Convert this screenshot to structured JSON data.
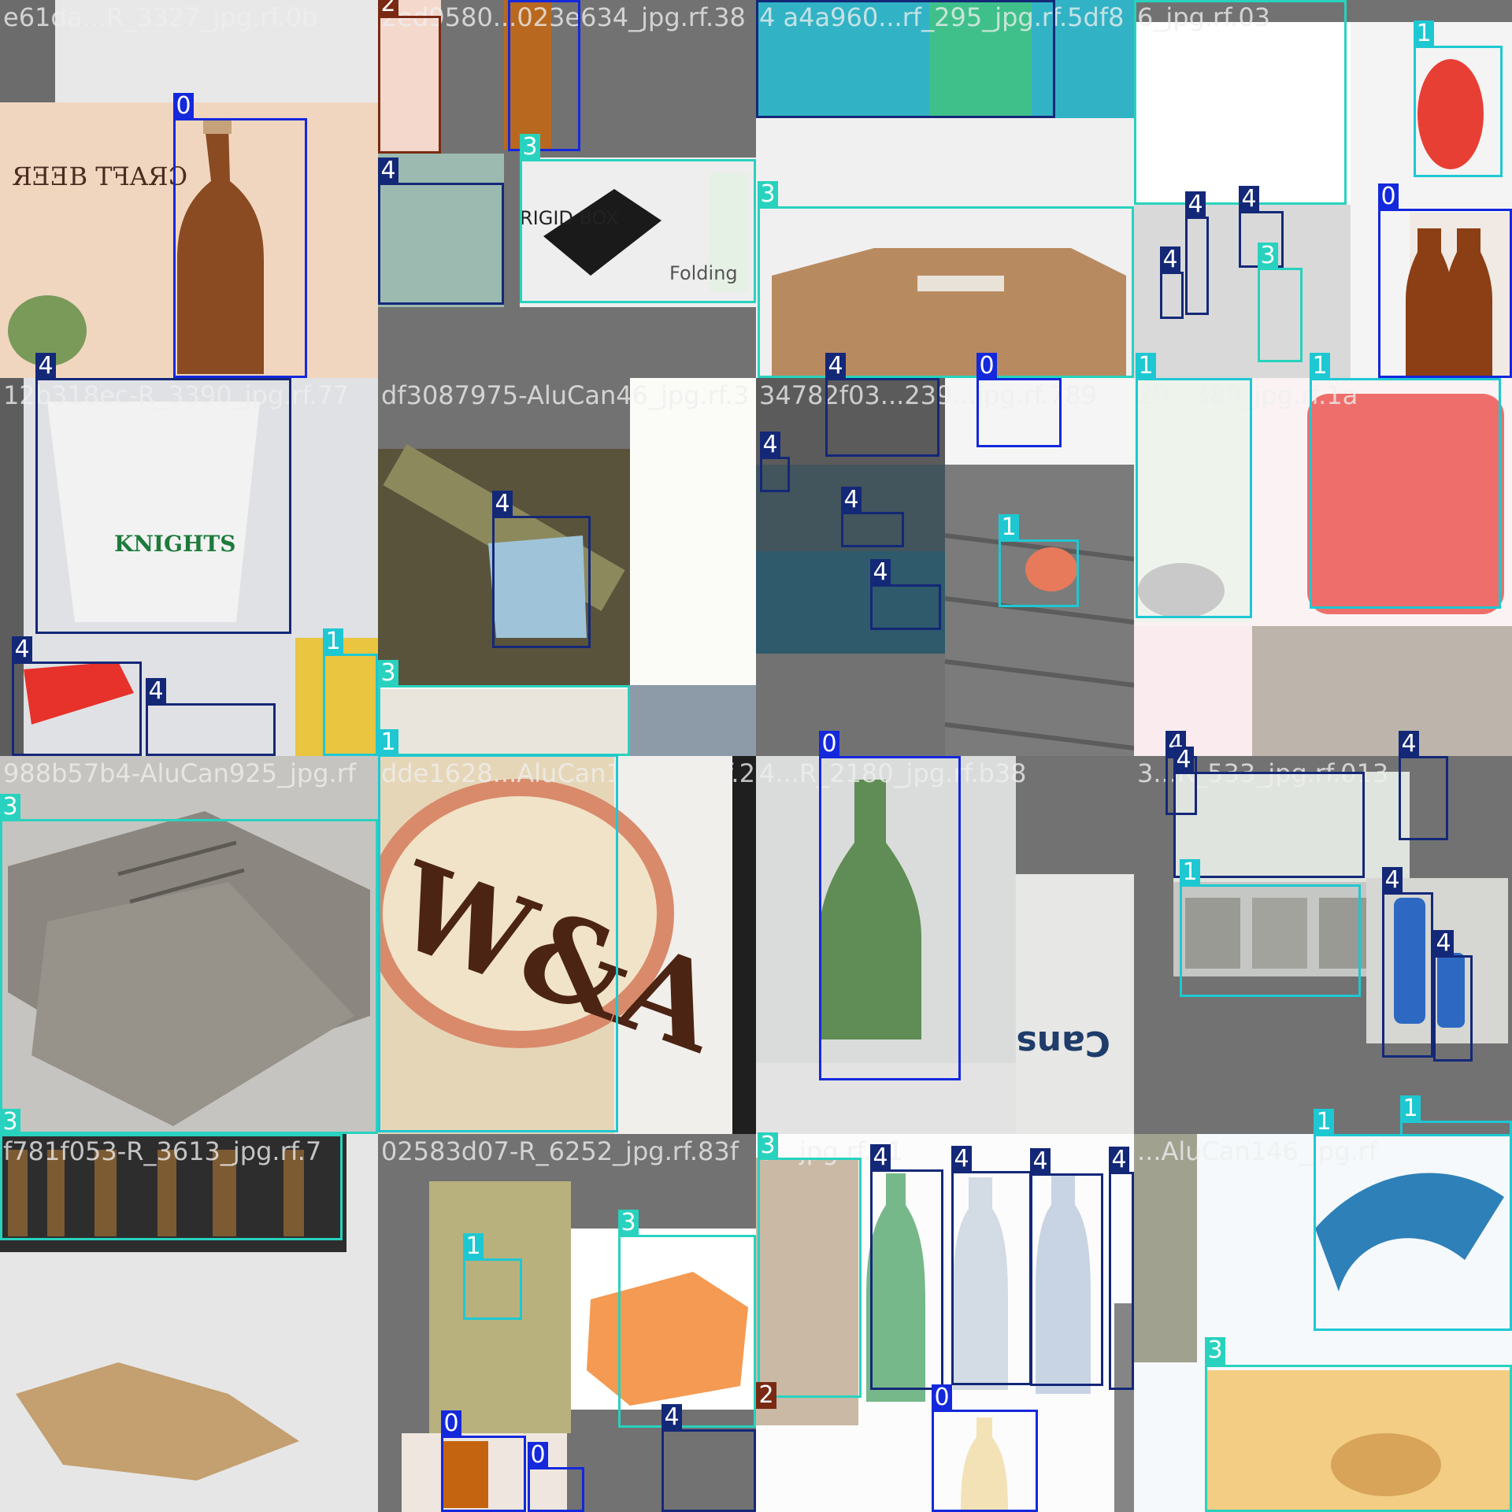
{
  "colors": {
    "class_0": "#1428dc",
    "class_1": "#1ec8d2",
    "class_2": "#7a2a12",
    "class_3": "#28d2be",
    "class_4": "#142878",
    "padding": "#727272"
  },
  "tiles": [
    {
      "caption": "e61da...R_3327_jpg.rf.0b",
      "scene": "craft-beer"
    },
    {
      "caption": "2ed9580...023e634_jpg.rf.38",
      "scene": "box-bottle"
    },
    {
      "caption": "4 a4a960...rf_295_jpg.rf.5df8",
      "scene": "cardboard-box"
    },
    {
      "caption": "6_jpg.rf.03",
      "scene": "newspaper-bottles"
    },
    {
      "caption": "12b318ec-R_3390_jpg.rf.77",
      "scene": "cup"
    },
    {
      "caption": "df3087975-AluCan46_jpg.rf.3",
      "scene": "bag-forest"
    },
    {
      "caption": "34782f03...239...jpg.rf.789",
      "scene": "debris"
    },
    {
      "caption": "29...389_jpg.rf.1a",
      "scene": "red-can"
    },
    {
      "caption": "988b57b4-AluCan925_jpg.rf",
      "scene": "paper"
    },
    {
      "caption": "dde1628...AluCan111_jpg.rf.28",
      "scene": "aw-can"
    },
    {
      "caption": "4...R_2180_jpg.rf.b38",
      "scene": "green-bottle"
    },
    {
      "caption": "3...R_533_jpg.rf.013",
      "scene": "tins-bottles"
    },
    {
      "caption": "f781f053-R_3613_jpg.rf.7",
      "scene": "books-box"
    },
    {
      "caption": "02583d07-R_6252_jpg.rf.83f",
      "scene": "orange-box"
    },
    {
      "caption": "3...jpg.rf.a1",
      "scene": "pet-bottles"
    },
    {
      "caption": "...AluCan146_jpg.rf",
      "scene": "splash"
    }
  ],
  "boxes": [
    {
      "label": "0",
      "cls": "c0"
    },
    {
      "label": "4",
      "cls": "c4"
    },
    {
      "label": "2",
      "cls": "c2"
    },
    {
      "label": "0",
      "cls": "c0"
    },
    {
      "label": "4",
      "cls": "c4"
    },
    {
      "label": "3",
      "cls": "c3"
    },
    {
      "label": "4",
      "cls": "c4"
    },
    {
      "label": "3",
      "cls": "c3"
    },
    {
      "label": "3",
      "cls": "c3"
    },
    {
      "label": "1",
      "cls": "c1"
    },
    {
      "label": "4",
      "cls": "c4"
    },
    {
      "label": "4",
      "cls": "c4"
    },
    {
      "label": "4",
      "cls": "c4"
    },
    {
      "label": "3",
      "cls": "c3"
    },
    {
      "label": "0",
      "cls": "c0"
    },
    {
      "label": "4",
      "cls": "c4"
    },
    {
      "label": "4",
      "cls": "c4"
    },
    {
      "label": "4",
      "cls": "c4"
    },
    {
      "label": "1",
      "cls": "c1"
    },
    {
      "label": "4",
      "cls": "c4"
    },
    {
      "label": "3",
      "cls": "c3"
    },
    {
      "label": "1",
      "cls": "c1"
    },
    {
      "label": "4",
      "cls": "c4"
    },
    {
      "label": "0",
      "cls": "c0"
    },
    {
      "label": "4",
      "cls": "c4"
    },
    {
      "label": "4",
      "cls": "c4"
    },
    {
      "label": "4",
      "cls": "c4"
    },
    {
      "label": "1",
      "cls": "c1"
    },
    {
      "label": "1",
      "cls": "c1"
    },
    {
      "label": "1",
      "cls": "c1"
    },
    {
      "label": "3",
      "cls": "c3"
    },
    {
      "label": "3",
      "cls": "c3"
    },
    {
      "label": "0",
      "cls": "c0"
    },
    {
      "label": "4",
      "cls": "c4"
    },
    {
      "label": "4",
      "cls": "c4"
    },
    {
      "label": "1",
      "cls": "c1"
    },
    {
      "label": "4",
      "cls": "c4"
    },
    {
      "label": "4",
      "cls": "c4"
    },
    {
      "label": "1",
      "cls": "c1"
    },
    {
      "label": "3",
      "cls": "c3"
    },
    {
      "label": "1",
      "cls": "c1"
    },
    {
      "label": "3",
      "cls": "c3"
    },
    {
      "label": "0",
      "cls": "c0"
    },
    {
      "label": "0",
      "cls": "c0"
    },
    {
      "label": "4",
      "cls": "c4"
    },
    {
      "label": "3",
      "cls": "c3"
    },
    {
      "label": "4",
      "cls": "c4"
    },
    {
      "label": "4",
      "cls": "c4"
    },
    {
      "label": "4",
      "cls": "c4"
    },
    {
      "label": "4",
      "cls": "c4"
    },
    {
      "label": "2",
      "cls": "c2"
    },
    {
      "label": "0",
      "cls": "c0"
    },
    {
      "label": "1",
      "cls": "c1"
    },
    {
      "label": "3",
      "cls": "c3"
    }
  ]
}
